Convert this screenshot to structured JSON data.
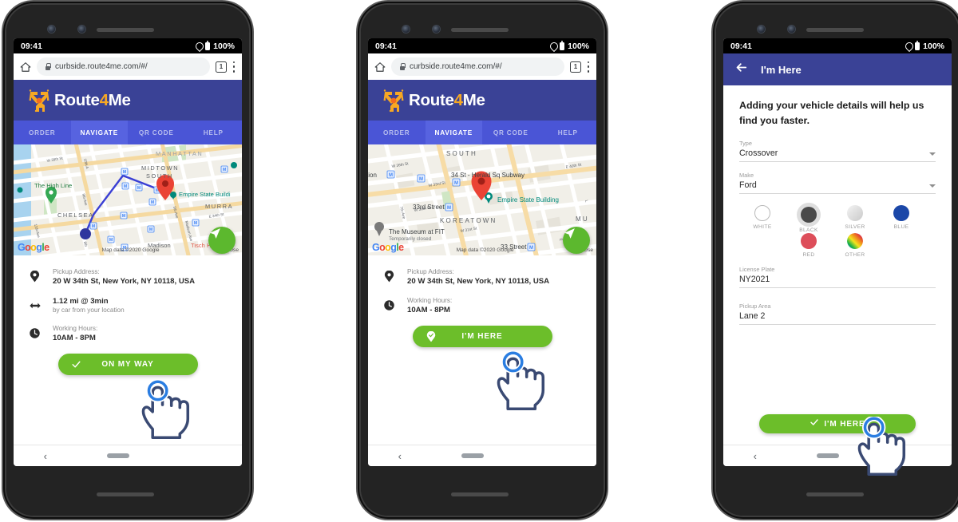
{
  "status_bar": {
    "time": "09:41",
    "battery": "100%",
    "location_icon": "location-pin-icon",
    "battery_icon": "battery-full-icon"
  },
  "browser": {
    "home_icon": "home-icon",
    "lock_icon": "lock-icon",
    "url": "curbside.route4me.com/#/",
    "tab_count": "1",
    "menu_icon": "kebab-menu-icon"
  },
  "brand": {
    "name_part1": "Route",
    "name_accent": "4",
    "name_part2": "Me",
    "header_color": "#3a4296",
    "accent_color": "#f7a823",
    "green": "#6cbe2a"
  },
  "tabs": [
    {
      "label": "ORDER",
      "active": false
    },
    {
      "label": "NAVIGATE",
      "active": true
    },
    {
      "label": "QR CODE",
      "active": false
    },
    {
      "label": "HELP",
      "active": false
    }
  ],
  "map1": {
    "labels": [
      "MANHATTAN",
      "MIDTOWN",
      "SOUTH",
      "The High Line",
      "CHELSEA",
      "Empire State Buildi",
      "MURRA",
      "Madison",
      "Tisch Hospita",
      "11th Ave",
      "9th Ave",
      "10th A",
      "8th",
      "5th Ave",
      "Madison Ave",
      "W 39th St",
      "E 34th St"
    ],
    "attribution": "Map data ©2020 Google",
    "terms": "Use",
    "google_logo": "Google",
    "navigate_fab_icon": "navigation-arrow-icon"
  },
  "map2": {
    "labels": [
      "SOUTH",
      "34 St - Herald Sq Subway",
      "Empire State Building",
      "33rd Street",
      "KOREATOWN",
      "The Museum at FIT",
      "Temporarily closed",
      "33 Street",
      "MU",
      "tion",
      "7th Ave",
      "W 33rd St",
      "W 30th St",
      "W 31st St",
      "E 40th St",
      "W 36th St"
    ],
    "attribution": "Map data ©2020 Google",
    "terms": "Use",
    "google_logo": "Google",
    "navigate_fab_icon": "navigation-arrow-icon"
  },
  "screen1": {
    "rows": [
      {
        "icon": "map-pin-icon",
        "label": "Pickup Address:",
        "value": "20 W 34th St, New York, NY 10118, USA",
        "sub": ""
      },
      {
        "icon": "distance-arrows-icon",
        "label": "",
        "value": "1.12 mi @ 3min",
        "sub": "by car from your location"
      },
      {
        "icon": "clock-icon",
        "label": "Working Hours:",
        "value": "10AM - 8PM",
        "sub": ""
      }
    ],
    "cta": {
      "label": "ON MY WAY",
      "icon": "checkmark-icon"
    }
  },
  "screen2": {
    "rows": [
      {
        "icon": "map-pin-icon",
        "label": "Pickup Address:",
        "value": "20 W 34th St, New York, NY 10118, USA",
        "sub": ""
      },
      {
        "icon": "clock-icon",
        "label": "Working Hours:",
        "value": "10AM - 8PM",
        "sub": ""
      }
    ],
    "cta": {
      "label": "I'M HERE",
      "icon": "pin-check-icon"
    }
  },
  "screen3": {
    "back_icon": "back-arrow-icon",
    "title": "I'm Here",
    "lead": "Adding your vehicle details will help us find you faster.",
    "fields": [
      {
        "label": "Type",
        "value": "Crossover",
        "kind": "select"
      },
      {
        "label": "Make",
        "value": "Ford",
        "kind": "select"
      }
    ],
    "colors": [
      {
        "label": "WHITE",
        "hex": "#ffffff",
        "selected": false
      },
      {
        "label": "BLACK",
        "hex": "#4a4a4a",
        "selected": true
      },
      {
        "label": "SILVER",
        "hex": "#d8d8d8",
        "selected": false
      },
      {
        "label": "BLUE",
        "hex": "#1b47a8",
        "selected": false
      },
      {
        "label": "RED",
        "hex": "#dd4e5a",
        "selected": false
      },
      {
        "label": "OTHER",
        "hex": "rainbow",
        "selected": false
      }
    ],
    "text_fields": [
      {
        "label": "License Plate",
        "value": "NY2021"
      },
      {
        "label": "Pickup Area",
        "value": "Lane 2"
      }
    ],
    "cta": {
      "label": "I'M HERE",
      "icon": "checkmark-icon"
    }
  },
  "android_nav": {
    "back_icon": "nav-back-icon",
    "home_icon": "nav-home-pill-icon"
  },
  "cursors": [
    {
      "name": "tap-hand-cursor",
      "target": "on-my-way-button"
    },
    {
      "name": "tap-hand-cursor",
      "target": "im-here-button"
    },
    {
      "name": "tap-hand-cursor",
      "target": "im-here-submit-button"
    }
  ]
}
